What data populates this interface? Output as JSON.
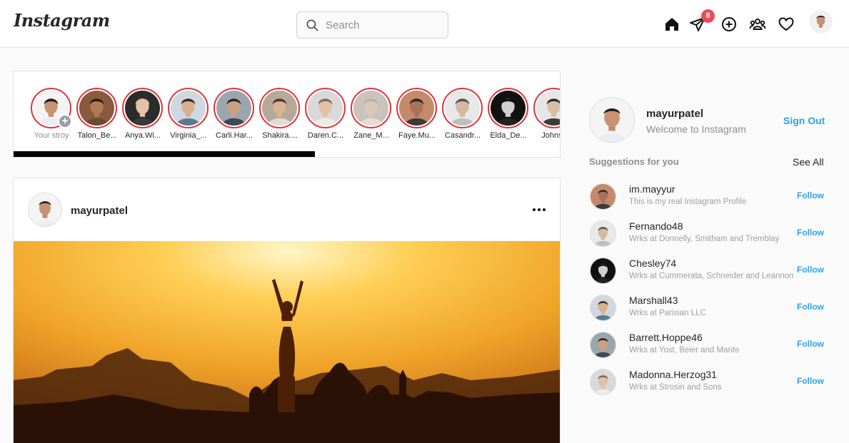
{
  "header": {
    "logo": "Instagram",
    "search_placeholder": "Search",
    "messages_badge": "8",
    "icons": [
      "home-icon",
      "direct-message-icon",
      "new-post-icon",
      "explore-people-icon",
      "activity-heart-icon"
    ]
  },
  "stories": [
    {
      "name": "Your stroy",
      "own": true
    },
    {
      "name": "Talon_Be..."
    },
    {
      "name": "Anya.Wi..."
    },
    {
      "name": "Virginia_..."
    },
    {
      "name": "Carli.Har..."
    },
    {
      "name": "Shakira...."
    },
    {
      "name": "Daren.C..."
    },
    {
      "name": "Zane_M..."
    },
    {
      "name": "Faye.Mu..."
    },
    {
      "name": "Casandr..."
    },
    {
      "name": "Elda_De..."
    },
    {
      "name": "Johnso"
    }
  ],
  "story_scroll_progress": 0.55,
  "post": {
    "username": "mayurpatel"
  },
  "profile": {
    "username": "mayurpatel",
    "welcome": "Welcome to Instagram",
    "sign_out": "Sign Out"
  },
  "suggestions": {
    "title": "Suggestions for you",
    "see_all": "See All",
    "follow_label": "Follow",
    "items": [
      {
        "name": "im.mayyur",
        "sub": "This is my real Instagram Profile"
      },
      {
        "name": "Fernando48",
        "sub": "Wrks at Donnelly, Smitham and Tremblay"
      },
      {
        "name": "Chesley74",
        "sub": "Wrks at Cummerata, Schneider and Leannon"
      },
      {
        "name": "Marshall43",
        "sub": "Wrks at Parisian LLC"
      },
      {
        "name": "Barrett.Hoppe46",
        "sub": "Wrks at Yost, Beier and Mante"
      },
      {
        "name": "Madonna.Herzog31",
        "sub": "Wrks at Strosin and Sons"
      }
    ]
  },
  "colors": {
    "accent": "#2aa5e8",
    "story_ring": "#e0333a",
    "badge": "#ed4956"
  }
}
